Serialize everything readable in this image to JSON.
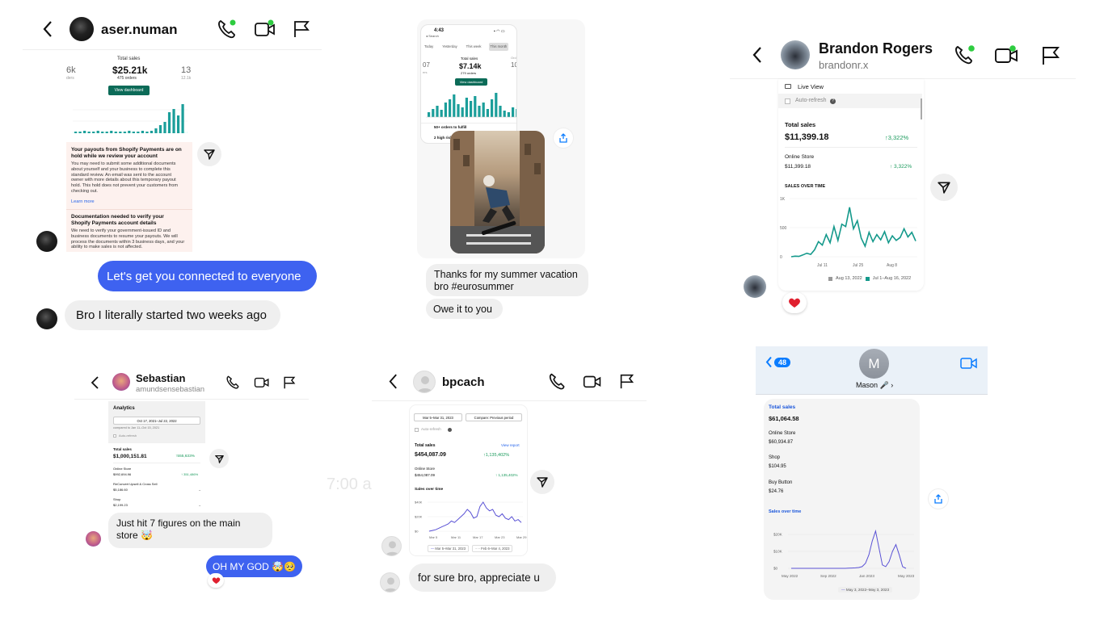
{
  "panel1": {
    "username": "aser.numan",
    "stats": {
      "left_value": "6k",
      "left_sub": "ders",
      "center_label": "Total sales",
      "center_value": "$25.21k",
      "center_sub": "475 orders",
      "right_value": "13",
      "right_sub": "12.1k",
      "button": "View dashboard"
    },
    "notice1_title": "Your payouts from Shopify Payments are on hold while we review your account",
    "notice1_body": "You may need to submit some additional documents about yourself and your business to complete this standard review. An email was sent to the account owner with more details about this temporary payout hold. This hold does not prevent your customers from checking out.",
    "learn_more": "Learn more",
    "notice2_title": "Documentation needed to verify your Shopify Payments account details",
    "notice2_body": "We need to verify your government-issued ID and business documents to resume your payouts. We will process the documents within 3 business days, and your ability to make sales is not affected.",
    "msg_sent": "Let's get you connected to everyone",
    "msg_received": "Bro I literally started two weeks ago"
  },
  "panel2": {
    "phone_time": "4:43",
    "phone_back": "◂ Search",
    "tabs": [
      "Today",
      "Yesterday",
      "This week",
      "This month"
    ],
    "total_label": "Total sales",
    "total_value": "$7.14k",
    "orders": "279 orders",
    "left_value": "07",
    "left_sub": "ers",
    "right_value": "10",
    "right_sub": "Ord",
    "button": "View dashboard",
    "row1": "50+ orders to fulfill",
    "row2": "2 high risk",
    "msg1": "Thanks for my summer vacation bro #eurosummer",
    "msg2": "Owe it to you"
  },
  "panel3": {
    "name": "Brandon Rogers",
    "handle": "brandonr.x",
    "live_view": "Live View",
    "auto_refresh": "Auto-refresh",
    "total_label": "Total sales",
    "total_value": "$11,399.18",
    "total_change": "↑3,322%",
    "online_label": "Online Store",
    "online_value": "$11,399.18",
    "online_change": "↑ 3,322%",
    "chart_title": "SALES OVER TIME",
    "legend1": "Aug 13, 2022",
    "legend2": "Jul 1–Aug 16, 2022"
  },
  "panel4": {
    "name": "Sebastian",
    "handle": "amundsensebastian",
    "analytics": "Analytics",
    "date_range": "Oct 17, 2021–Jul 22, 2022",
    "compared": "compared to Jan 11–Oct 15, 2021",
    "auto_refresh": "Auto-refresh",
    "total_label": "Total sales",
    "total_value": "$1,000,151.81",
    "total_change": "↑555,633%",
    "online_label": "Online Store",
    "online_value": "$992,694.96",
    "online_change": "↑ 351,486%",
    "reconvert_label": "ReConvert Upsell & Cross Sell",
    "reconvert_value": "$5,186.60",
    "shop_label": "Shop",
    "shop_value": "$2,199.23",
    "msg_received": "Just hit 7 figures on the main store 🤯",
    "msg_sent": "OH MY GOD 🤯🥺"
  },
  "panel5": {
    "name": "bpcach",
    "date_range": "Mar 5–Mar 31, 2023",
    "compare": "Compare: Previous period",
    "auto_refresh": "Auto-refresh",
    "total_label": "Total sales",
    "view_report": "View report",
    "total_value": "$454,087.09",
    "total_change": "↑1,135,402%",
    "online_label": "Online Store",
    "online_value": "$454,087.09",
    "online_change": "↑ 1,135,402%",
    "chart_title": "Sales over time",
    "y_ticks": [
      "$40K",
      "$20K",
      "$0"
    ],
    "x_ticks": [
      "Mar 5",
      "Mar 11",
      "Mar 17",
      "Mar 23",
      "Mar 29"
    ],
    "legend1": "Mar 5–Mar 31, 2023",
    "legend2": "Feb 6–Mar 4, 2023",
    "ghost_time": "7:00 a",
    "msg_received": "for sure bro, appreciate u"
  },
  "panel6": {
    "back_count": "48",
    "avatar_letter": "M",
    "contact": "Mason 🎤 ›",
    "total_label": "Total sales",
    "total_value": "$61,064.58",
    "online_label": "Online Store",
    "online_value": "$60,934.87",
    "shop_label": "Shop",
    "shop_value": "$104.95",
    "buy_label": "Buy Button",
    "buy_value": "$24.76",
    "chart_title": "Sales over time",
    "y_ticks": [
      "$20K",
      "$10K",
      "$0"
    ],
    "x_ticks": [
      "May 2022",
      "Sep 2022",
      "Jan 2023",
      "May 2023"
    ],
    "legend": "May 3, 2022–May 3, 2023"
  },
  "colors": {
    "ig_blue": "#3e62f0",
    "shopify_green": "#1a9a5c",
    "teal_bars": "#1b9e9a",
    "online_dot": "#2ecc40",
    "ios_blue": "#0a7cff"
  }
}
